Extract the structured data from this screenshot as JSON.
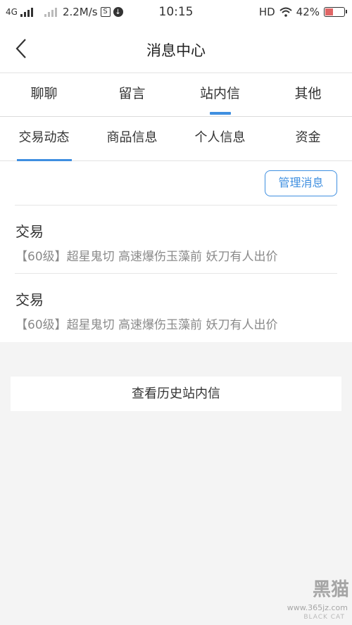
{
  "status_bar": {
    "network": "4G",
    "speed": "2.2M/s",
    "sim_badge": "S",
    "time": "10:15",
    "hd": "HD",
    "battery": "42%",
    "battery_level": 0.42
  },
  "nav": {
    "title": "消息中心"
  },
  "primary_tabs": [
    {
      "label": "聊聊",
      "active": false
    },
    {
      "label": "留言",
      "active": false
    },
    {
      "label": "站内信",
      "active": true
    },
    {
      "label": "其他",
      "active": false
    }
  ],
  "secondary_tabs": [
    {
      "label": "交易动态",
      "active": true
    },
    {
      "label": "商品信息",
      "active": false
    },
    {
      "label": "个人信息",
      "active": false
    },
    {
      "label": "资金",
      "active": false
    }
  ],
  "manage_button": "管理消息",
  "messages": [
    {
      "title": "交易",
      "desc": "【60级】超星鬼切 高速爆伤玉藻前 妖刀有人出价"
    },
    {
      "title": "交易",
      "desc": "【60级】超星鬼切 高速爆伤玉藻前 妖刀有人出价"
    }
  ],
  "history_button": "查看历史站内信",
  "watermark": {
    "text": "黑猫",
    "url": "www.365jz.com",
    "sub": "BLACK CAT"
  },
  "colors": {
    "accent": "#3f8fe0",
    "background": "#f4f4f4"
  }
}
